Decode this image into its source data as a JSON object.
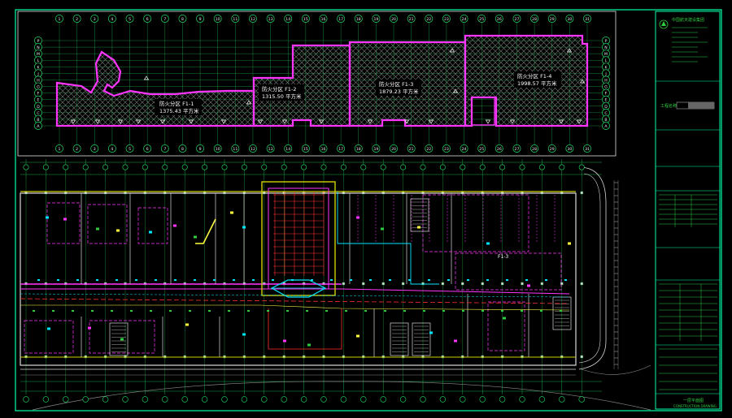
{
  "colors": {
    "background": "#000000",
    "frame": "#00ffa8",
    "axis": "#22e06a",
    "zone": "#ff35ff",
    "hatch": "#8a8a8a",
    "wall": "#d0d000",
    "cyan": "#00e6ff",
    "text": "#ffffff"
  },
  "key_plan": {
    "zones": [
      {
        "name": "防火分区 F1-1",
        "area": "1375.43 平方米"
      },
      {
        "name": "防火分区 F1-2",
        "area": "1315.50 平方米"
      },
      {
        "name": "防火分区 F1-3",
        "area": "1879.23 平方米"
      },
      {
        "name": "防火分区 F1-4",
        "area": "1998.57 平方米"
      }
    ],
    "axis_numbers": [
      "1",
      "2",
      "3",
      "4",
      "5",
      "6",
      "7",
      "8",
      "9",
      "10",
      "11",
      "12",
      "13",
      "14",
      "15",
      "16",
      "17",
      "18",
      "19",
      "20",
      "21",
      "22",
      "23",
      "24",
      "25",
      "26",
      "27",
      "28",
      "29",
      "30",
      "31"
    ],
    "axis_letters_left": [
      "P",
      "N",
      "M",
      "L",
      "K",
      "J",
      "H",
      "G",
      "F",
      "E",
      "D",
      "C",
      "B",
      "A"
    ],
    "axis_letters_right": [
      "P",
      "N",
      "M",
      "L",
      "K",
      "J",
      "H",
      "G",
      "F",
      "E",
      "D",
      "C",
      "B",
      "A"
    ]
  },
  "title_block": {
    "company": "中国航天建设集团",
    "project_label": "工程名称",
    "drawing_title": "一层平面图",
    "footer": "CONSTRUCTION DRAWING"
  },
  "floor_plan": {
    "zone_label": "F1-3"
  }
}
